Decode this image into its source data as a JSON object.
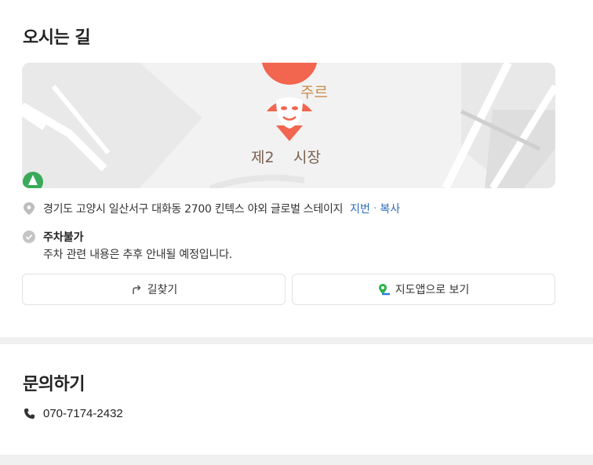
{
  "directions": {
    "title": "오시는 길",
    "map": {
      "labels": [
        "주르",
        "제2",
        "시장"
      ]
    },
    "address": {
      "text": "경기도 고양시 일산서구 대화동 2700 킨텍스 야외 글로벌 스테이지",
      "jibun_label": "지번",
      "separator": "·",
      "copy_label": "복사"
    },
    "parking": {
      "title": "주차불가",
      "description": "주차 관련 내용은 추후 안내될 예정입니다."
    },
    "buttons": {
      "route_label": "길찾기",
      "map_app_label": "지도앱으로 보기"
    }
  },
  "inquiry": {
    "title": "문의하기",
    "phone": "070-7174-2432"
  },
  "colors": {
    "marker": "#f2654f",
    "link": "#2b6bb6",
    "divider": "#f0f0f0"
  }
}
